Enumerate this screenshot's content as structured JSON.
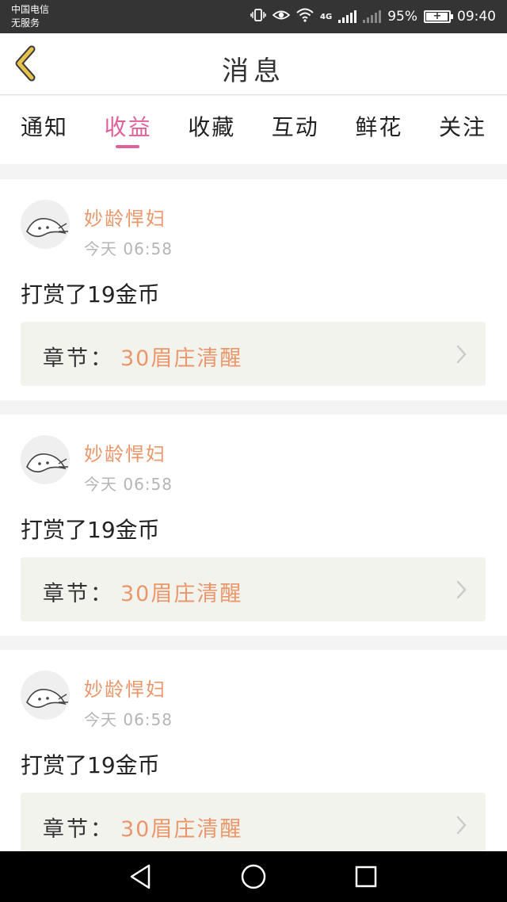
{
  "status_bar": {
    "carrier_line1": "中国电信",
    "carrier_line2": "无服务",
    "network": "4G",
    "battery": "95%",
    "time": "09:40"
  },
  "header": {
    "title": "消息",
    "back_icon": "chevron-left-icon",
    "accent_color": "#e0609a",
    "back_color": "#e6c34a"
  },
  "tabs": [
    {
      "label": "通知",
      "active": false
    },
    {
      "label": "收益",
      "active": true
    },
    {
      "label": "收藏",
      "active": false
    },
    {
      "label": "互动",
      "active": false
    },
    {
      "label": "鲜花",
      "active": false
    },
    {
      "label": "关注",
      "active": false
    }
  ],
  "feed": [
    {
      "username": "妙龄悍妇",
      "time": "今天 06:58",
      "message": "打赏了19金币",
      "chapter_label": "章节：",
      "chapter_title": "30眉庄清醒"
    },
    {
      "username": "妙龄悍妇",
      "time": "今天 06:58",
      "message": "打赏了19金币",
      "chapter_label": "章节：",
      "chapter_title": "30眉庄清醒"
    },
    {
      "username": "妙龄悍妇",
      "time": "今天 06:58",
      "message": "打赏了19金币",
      "chapter_label": "章节：",
      "chapter_title": "30眉庄清醒"
    }
  ],
  "nav_bar": {
    "back_icon": "triangle-back-icon",
    "home_icon": "circle-home-icon",
    "recents_icon": "square-recents-icon"
  }
}
